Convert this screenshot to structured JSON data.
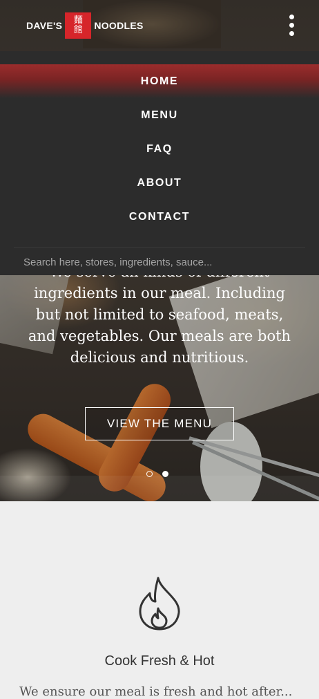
{
  "brand": {
    "left_word": "DAVE'S",
    "right_word": "NOODLES",
    "seal_text": "麵館",
    "seal_color": "#d6252a"
  },
  "menu_button": {
    "icon": "vertical-dots-icon"
  },
  "nav": {
    "items": [
      {
        "label": "HOME",
        "active": true
      },
      {
        "label": "MENU",
        "active": false
      },
      {
        "label": "FAQ",
        "active": false
      },
      {
        "label": "ABOUT",
        "active": false
      },
      {
        "label": "CONTACT",
        "active": false
      }
    ],
    "search_placeholder": "Search here, stores, ingredients, sauce..."
  },
  "hero": {
    "text": "We serve all kinds of different ingredients in our meal. Including but not limited to seafood, meats, and vegetables. Our meals are both delicious and nutritious.",
    "button_label": "VIEW THE MENU",
    "slides": 2,
    "active_slide": 2
  },
  "feature": {
    "icon": "flame-icon",
    "title": "Cook Fresh & Hot",
    "text": "We ensure our meal is fresh and hot after..."
  },
  "colors": {
    "accent": "#9b2c2c",
    "nav_bg": "#2c2c2c",
    "section_bg": "#eeeeee"
  }
}
